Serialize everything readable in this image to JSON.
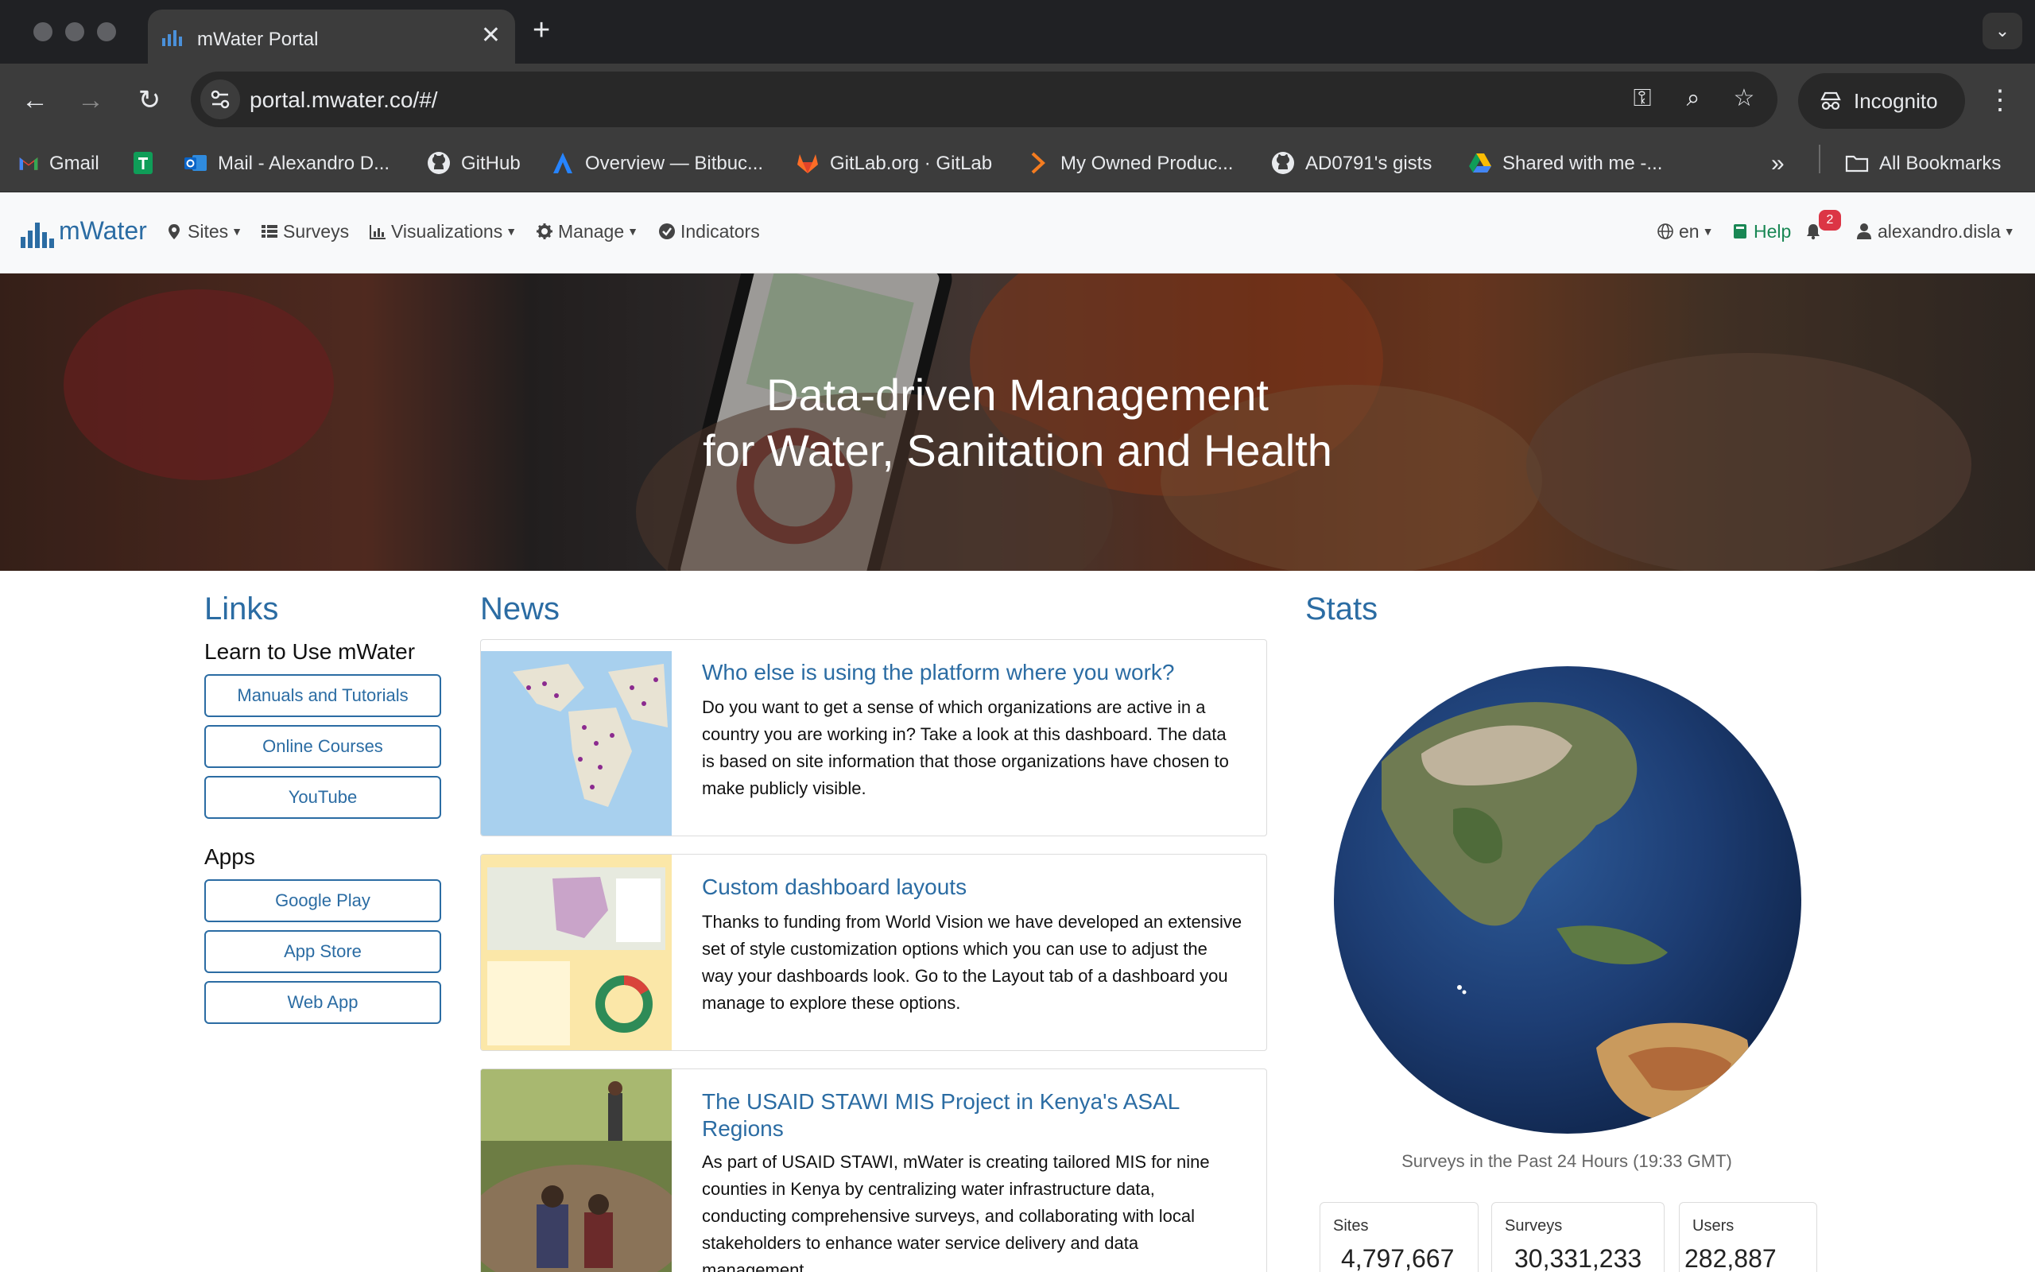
{
  "browser": {
    "tab_title": "mWater Portal",
    "url": "portal.mwater.co/#/",
    "incognito_label": "Incognito",
    "bookmarks": [
      {
        "label": "Gmail",
        "icon": "gmail-icon"
      },
      {
        "label": "",
        "icon": "google-sheets-icon"
      },
      {
        "label": "Mail - Alexandro D...",
        "icon": "outlook-icon"
      },
      {
        "label": "GitHub",
        "icon": "github-icon"
      },
      {
        "label": "Overview — Bitbuc...",
        "icon": "bitbucket-icon"
      },
      {
        "label": "GitLab.org · GitLab",
        "icon": "gitlab-icon"
      },
      {
        "label": "My Owned Produc...",
        "icon": "chevron-brand-icon"
      },
      {
        "label": "AD0791's gists",
        "icon": "github-icon"
      },
      {
        "label": "Shared with me -...",
        "icon": "google-drive-icon"
      }
    ],
    "more_bookmarks": "»",
    "all_bookmarks": "All Bookmarks"
  },
  "app": {
    "brand": "mWater",
    "nav": [
      {
        "label": "Sites",
        "icon": "map-pin-icon",
        "dropdown": true
      },
      {
        "label": "Surveys",
        "icon": "list-icon",
        "dropdown": false
      },
      {
        "label": "Visualizations",
        "icon": "bar-chart-icon",
        "dropdown": true
      },
      {
        "label": "Manage",
        "icon": "gear-icon",
        "dropdown": true
      },
      {
        "label": "Indicators",
        "icon": "check-circle-icon",
        "dropdown": false
      }
    ],
    "language": "en",
    "help": "Help",
    "notification_count": "2",
    "user": "alexandro.disla"
  },
  "hero": {
    "line1": "Data-driven Management",
    "line2": "for Water, Sanitation and Health"
  },
  "links": {
    "title": "Links",
    "learn_heading": "Learn to Use mWater",
    "learn_buttons": [
      "Manuals and Tutorials",
      "Online Courses",
      "YouTube"
    ],
    "apps_heading": "Apps",
    "app_buttons": [
      "Google Play",
      "App Store",
      "Web App"
    ]
  },
  "news": {
    "title": "News",
    "items": [
      {
        "title": "Who else is using the platform where you work?",
        "body": "Do you want to get a sense of which organizations are active in a country you are working in? Take a look at this dashboard. The data is based on site information that those organizations have chosen to make publicly visible."
      },
      {
        "title": "Custom dashboard layouts",
        "body": "Thanks to funding from World Vision we have developed an extensive set of style customization options which you can use to adjust the way your dashboards look. Go to the Layout tab of a dashboard you manage to explore these options."
      },
      {
        "title": "The USAID STAWI MIS Project in Kenya's ASAL Regions",
        "body": "As part of USAID STAWI, mWater is creating tailored MIS for nine counties in Kenya by centralizing water infrastructure data, conducting comprehensive surveys, and collaborating with local stakeholders to enhance water service delivery and data management."
      }
    ]
  },
  "stats": {
    "title": "Stats",
    "caption": "Surveys in the Past 24 Hours (19:33 GMT)",
    "cards": [
      {
        "label": "Sites",
        "value": "4,797,667"
      },
      {
        "label": "Surveys",
        "value": "30,331,233"
      },
      {
        "label": "Users",
        "value": "282,887"
      }
    ]
  },
  "colors": {
    "brand_blue": "#2b6ca3",
    "help_green": "#198754",
    "badge_red": "#dc3545"
  }
}
